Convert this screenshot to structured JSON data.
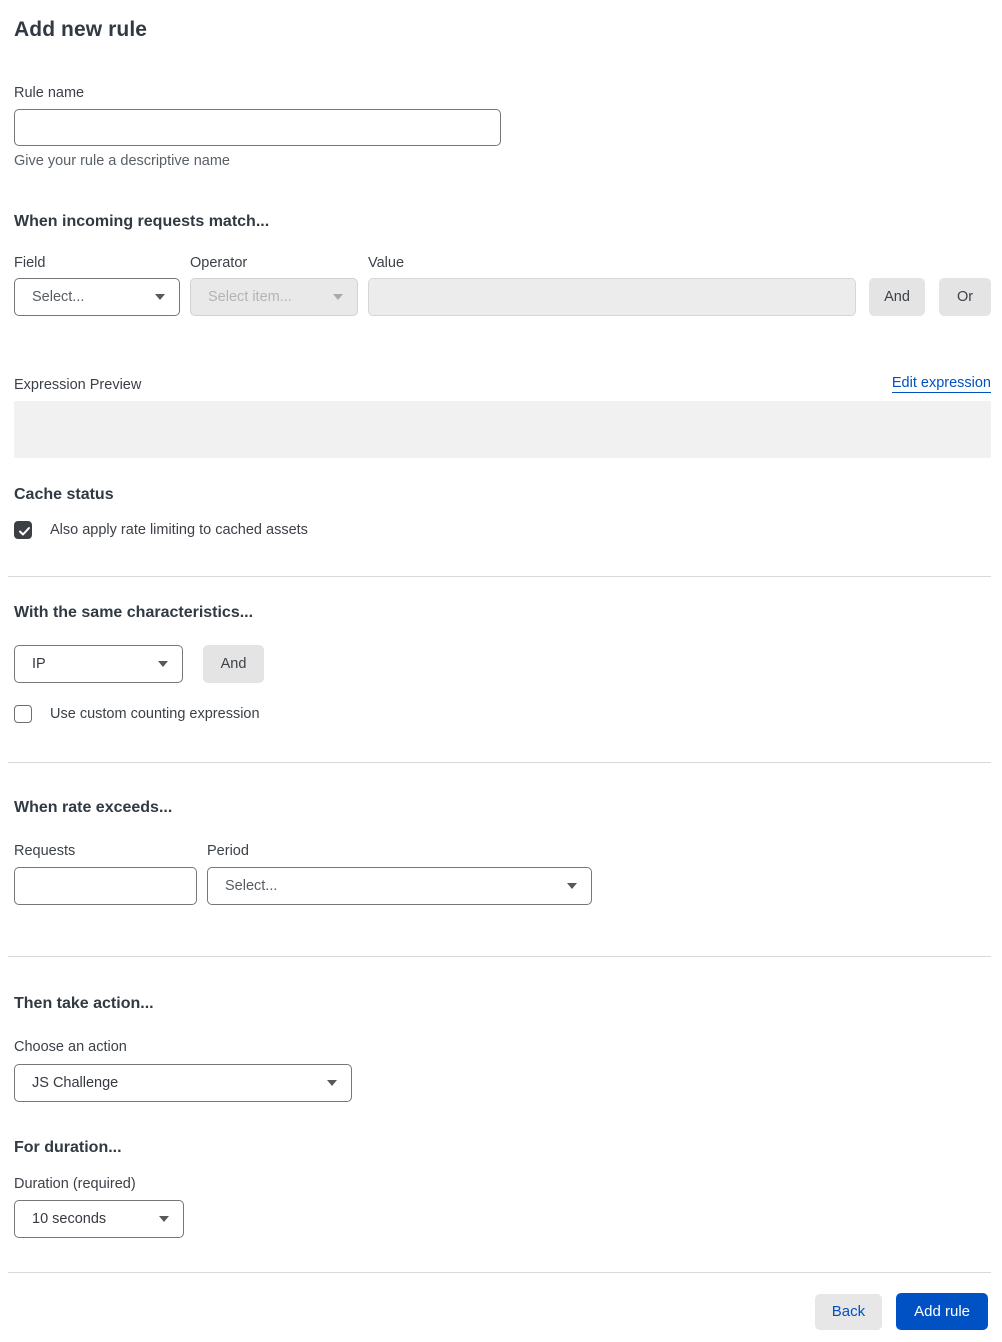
{
  "page": {
    "title": "Add new rule"
  },
  "rule_name": {
    "label": "Rule name",
    "value": "",
    "helper": "Give your rule a descriptive name"
  },
  "match": {
    "heading": "When incoming requests match...",
    "field": {
      "label": "Field",
      "selected": "Select...",
      "enabled": true
    },
    "operator": {
      "label": "Operator",
      "selected": "Select item...",
      "enabled": false
    },
    "value": {
      "label": "Value",
      "value": "",
      "enabled": false
    },
    "and_button": "And",
    "or_button": "Or"
  },
  "expression": {
    "label": "Expression Preview",
    "edit_link": "Edit expression",
    "content": ""
  },
  "cache_status": {
    "heading": "Cache status",
    "checkbox_label": "Also apply rate limiting to cached assets",
    "checked": true
  },
  "characteristics": {
    "heading": "With the same characteristics...",
    "select_selected": "IP",
    "and_button": "And",
    "checkbox_label": "Use custom counting expression",
    "checked": false
  },
  "rate": {
    "heading": "When rate exceeds...",
    "requests": {
      "label": "Requests",
      "value": ""
    },
    "period": {
      "label": "Period",
      "selected": "Select..."
    }
  },
  "action": {
    "heading": "Then take action...",
    "label": "Choose an action",
    "selected": "JS Challenge"
  },
  "duration": {
    "heading": "For duration...",
    "label": "Duration (required)",
    "selected": "10 seconds"
  },
  "footer": {
    "back_label": "Back",
    "add_rule_label": "Add rule"
  },
  "colors": {
    "accent_blue": "#0051c3",
    "heading_dark": "#313a42",
    "divider_gray": "#d9d9d9",
    "disabled_bg": "#ececec",
    "button_gray": "#e4e4e4",
    "preview_bg": "#f1f1f1",
    "checkbox_dark": "#3c4044"
  }
}
